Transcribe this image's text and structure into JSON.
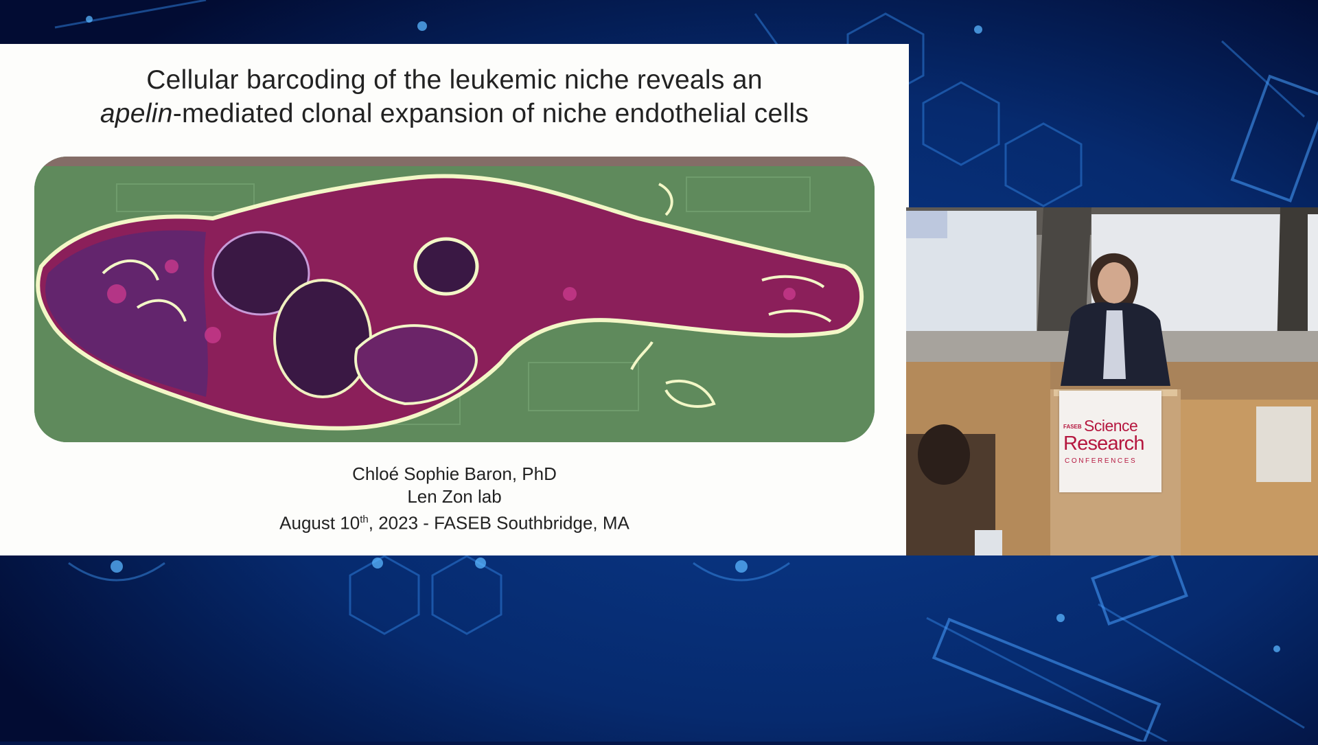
{
  "slide": {
    "title_line1": "Cellular barcoding of the leukemic niche reveals an",
    "title_line2_italic": "apelin",
    "title_line2_rest": "-mediated clonal expansion of niche endothelial cells",
    "presenter": "Chloé Sophie Baron, PhD",
    "lab": "Len Zon lab",
    "date_prefix": "August 10",
    "date_superscript": "th",
    "date_suffix": ", 2023 - FASEB Southbridge, MA"
  },
  "figure": {
    "icon": "zebrafish-section-image"
  },
  "camera_feed": {
    "icon": "speaker-at-podium-video"
  },
  "podium_logo": {
    "faseb": "FASEB",
    "science": "Science",
    "research": "Research",
    "conferences": "CONFERENCES"
  },
  "colors": {
    "background": "#04164a",
    "slide_bg": "#fdfdfb",
    "brand": "#b5173f",
    "figure_bg": "#5f8a5c",
    "tissue": "#8b1f5a"
  }
}
